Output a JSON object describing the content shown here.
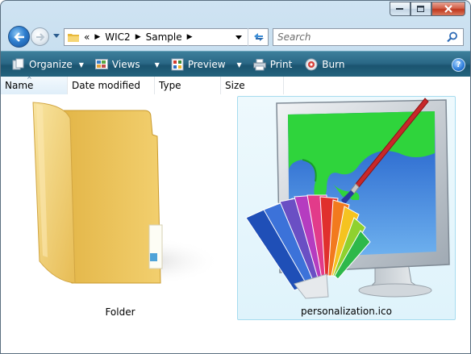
{
  "window": {
    "caption_buttons": [
      {
        "name": "minimize",
        "icon": "minimize-icon"
      },
      {
        "name": "maximize",
        "icon": "maximize-icon"
      },
      {
        "name": "close",
        "icon": "close-icon"
      }
    ]
  },
  "address_bar": {
    "overflow": "«",
    "crumbs": [
      "WIC2",
      "Sample"
    ],
    "separator": "▶"
  },
  "search": {
    "placeholder": "Search"
  },
  "toolbar": {
    "organize": "Organize",
    "views": "Views",
    "preview": "Preview",
    "print": "Print",
    "burn": "Burn",
    "help": "?"
  },
  "columns": {
    "name": "Name",
    "date_modified": "Date modified",
    "type": "Type",
    "size": "Size"
  },
  "items": [
    {
      "label": "Folder",
      "icon": "folder-icon",
      "selected": false
    },
    {
      "label": "personalization.ico",
      "icon": "personalization-icon",
      "selected": true
    }
  ],
  "colors": {
    "command_bar": "#1b5470",
    "selection": "#dff3fb",
    "selection_border": "#a6dcef"
  }
}
